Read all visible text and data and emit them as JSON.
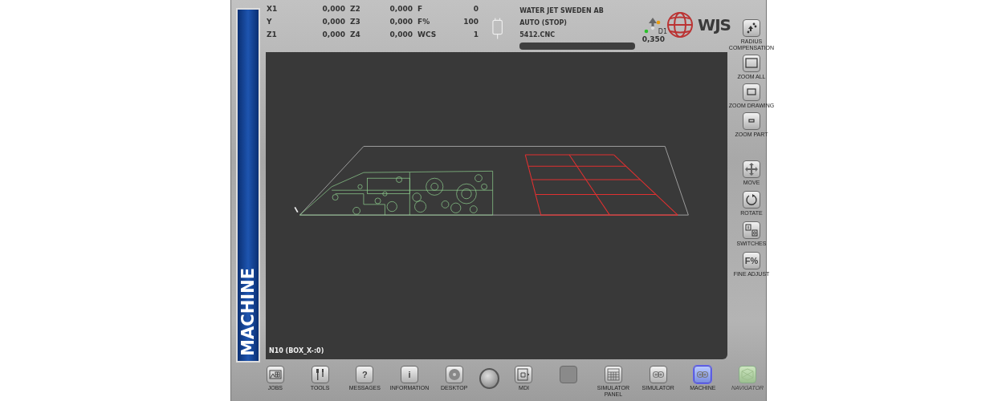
{
  "sidebar": {
    "title": "MACHINE"
  },
  "readouts": [
    {
      "cells": [
        {
          "label": "X1",
          "value": "0,000"
        },
        {
          "label": "Z2",
          "value": "0,000"
        },
        {
          "label": "F",
          "value": "0"
        }
      ]
    },
    {
      "cells": [
        {
          "label": "Y",
          "value": "0,000"
        },
        {
          "label": "Z3",
          "value": "0,000"
        },
        {
          "label": "F%",
          "value": "100"
        }
      ]
    },
    {
      "cells": [
        {
          "label": "Z1",
          "value": "0,000"
        },
        {
          "label": "Z4",
          "value": "0,000"
        },
        {
          "label": "WCS",
          "value": "1"
        }
      ]
    }
  ],
  "job": {
    "company": "WATER JET SWEDEN AB",
    "mode": "AUTO (STOP)",
    "file": "5412.CNC",
    "progress": {
      "level": 0
    }
  },
  "tool": {
    "label": "D1",
    "value": "0,350"
  },
  "logo": {
    "text": "WJS"
  },
  "view_buttons": [
    {
      "label": "RADIUS COMPENSATION",
      "kind": "radius"
    },
    {
      "label": "ZOOM ALL",
      "kind": "zoom-all"
    },
    {
      "label": "ZOOM DRAWING",
      "kind": "zoom-drawing"
    },
    {
      "label": "ZOOM PART",
      "kind": "zoom-part"
    }
  ],
  "edit_buttons": [
    {
      "label": "MOVE",
      "kind": "move"
    },
    {
      "label": "ROTATE",
      "kind": "rotate"
    },
    {
      "label": "SWITCHES",
      "kind": "switches"
    },
    {
      "label": "FINE ADJUST",
      "kind": "text",
      "icon_text": "F%"
    }
  ],
  "canvas": {
    "status": "N10 (BOX_X-:0)"
  },
  "bottom_buttons": [
    {
      "label": "JOBS",
      "kind": "jobs",
      "selected": false,
      "disabled": false
    },
    {
      "label": "TOOLS",
      "kind": "tools",
      "selected": false,
      "disabled": false
    },
    {
      "label": "MESSAGES",
      "kind": "text",
      "icon_text": "?",
      "selected": false,
      "disabled": false
    },
    {
      "label": "INFORMATION",
      "kind": "text",
      "icon_text": "i",
      "selected": false,
      "disabled": false
    },
    {
      "label": "DESKTOP",
      "kind": "disc",
      "selected": false,
      "disabled": false
    },
    {
      "kind": "knob",
      "selected": false,
      "disabled": false
    },
    {
      "label": "MDI",
      "kind": "hand",
      "selected": false,
      "disabled": false
    },
    {
      "kind": "blank",
      "selected": false,
      "disabled": false
    },
    {
      "label": "SIMULATOR PANEL",
      "kind": "grid",
      "selected": false,
      "disabled": false
    },
    {
      "label": "SIMULATOR",
      "kind": "gears",
      "selected": false,
      "disabled": false
    },
    {
      "label": "MACHINE",
      "kind": "gears",
      "selected": true,
      "disabled": false
    },
    {
      "label": "NAVIGATOR",
      "kind": "pattern",
      "selected": false,
      "disabled": true
    }
  ]
}
